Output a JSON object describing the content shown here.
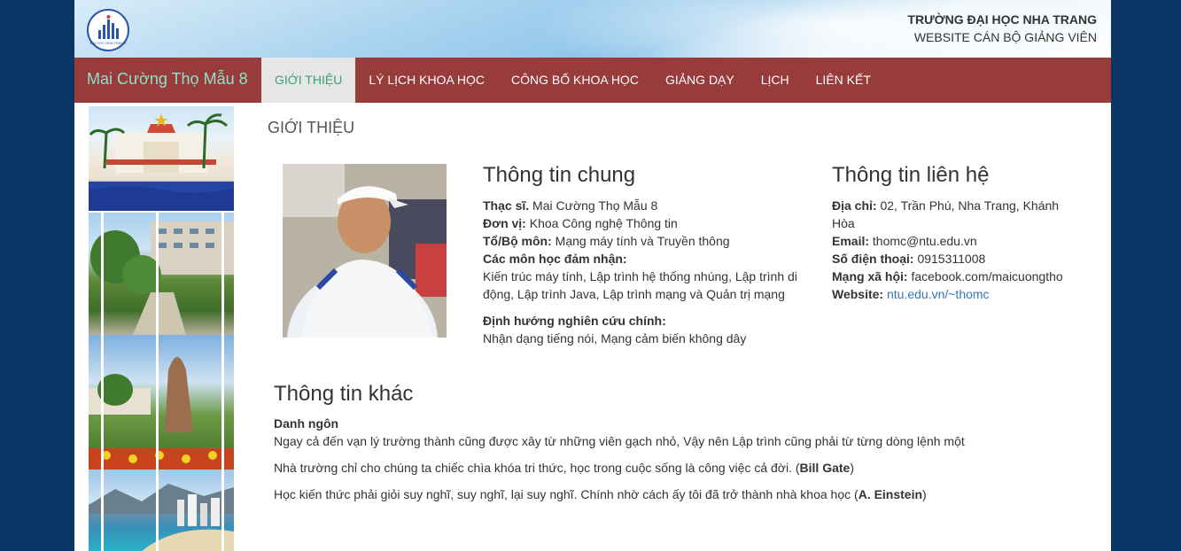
{
  "header": {
    "logo_text": "ĐẠI HỌC NHA TRANG",
    "school_name": "TRƯỜNG ĐẠI HỌC NHA TRANG",
    "site_name": "WEBSITE CÁN BỘ GIẢNG VIÊN"
  },
  "nav": {
    "brand": "Mai Cường Thọ Mẫu 8",
    "items": [
      {
        "label": "GIỚI THIỆU",
        "active": true
      },
      {
        "label": "LÝ LỊCH KHOA HỌC"
      },
      {
        "label": "CÔNG BỐ KHOA HỌC"
      },
      {
        "label": "GIẢNG DẠY"
      },
      {
        "label": "LỊCH"
      },
      {
        "label": "LIÊN KẾT"
      }
    ]
  },
  "main": {
    "section_title": "GIỚI THIỆU",
    "general": {
      "heading": "Thông tin chung",
      "degree_label": "Thạc sĩ.",
      "name": " Mai Cường Thọ Mẫu 8",
      "unit_label": "Đơn vị:",
      "unit": " Khoa Công nghệ Thông tin",
      "dept_label": "Tổ/Bộ môn:",
      "dept": " Mạng máy tính và Truyền thông",
      "courses_label": "Các môn học đảm nhận:",
      "courses": "Kiến trúc máy tính, Lập trình hệ thống nhúng, Lập trình di động, Lập trình Java, Lập trình mạng và Quản trị mạng",
      "research_label": "Định hướng nghiên cứu chính:",
      "research": "Nhận dạng tiếng nói, Mạng cảm biến không dây"
    },
    "contact": {
      "heading": "Thông tin liên hệ",
      "address_label": "Địa chỉ:",
      "address": " 02, Trần Phú, Nha Trang, Khánh Hòa",
      "email_label": "Email:",
      "email": " thomc@ntu.edu.vn",
      "phone_label": "Số điện thoại:",
      "phone": " 0915311008",
      "social_label": "Mạng xã hội:",
      "social": " facebook.com/maicuongtho",
      "website_label": "Website:",
      "website": "ntu.edu.vn/~thomc"
    },
    "other": {
      "heading": "Thông tin khác",
      "quotes_label": "Danh ngôn",
      "quote1": "Ngay cả đến vạn lý trường thành cũng được xây từ những viên gạch nhỏ, Vậy nên Lập trình cũng phải từ từng dòng lệnh một",
      "quote2": "Nhà trường chỉ cho chúng ta chiếc chìa khóa tri thức, học trong cuộc sống là công việc cả đời. (",
      "quote2_author": "Bill Gate",
      "quote2_end": ")",
      "quote3": " Học kiến thức phải giỏi suy nghĩ, suy nghĩ, lại suy nghĩ. Chính nhờ cách ấy tôi đã trở thành nhà khoa học (",
      "quote3_author": "A. Einstein",
      "quote3_end": ")"
    }
  },
  "colors": {
    "outer_bg": "#0b3564",
    "nav_bg": "#973b3b",
    "brand": "#8fe0c8",
    "active_tab_text": "#3aa272",
    "link": "#3575b8"
  },
  "icons": [
    "ntu-logo-icon"
  ]
}
